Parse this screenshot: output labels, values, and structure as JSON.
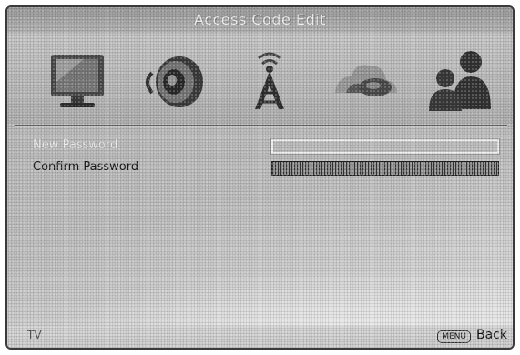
{
  "title": "Access Code Edit",
  "menu_icons": [
    "tv-icon",
    "speaker-icon",
    "antenna-icon",
    "network-icon",
    "users-icon"
  ],
  "form": {
    "new_password_label": "New Password",
    "new_password_value": "",
    "confirm_password_label": "Confirm Password",
    "confirm_password_value": ""
  },
  "footer": {
    "source": "TV",
    "menu_key": "MENU",
    "back": "Back"
  },
  "colors": {
    "background": "#bdbdbd",
    "highlight_text": "#f2f2f2",
    "text": "#1a1a1a"
  }
}
